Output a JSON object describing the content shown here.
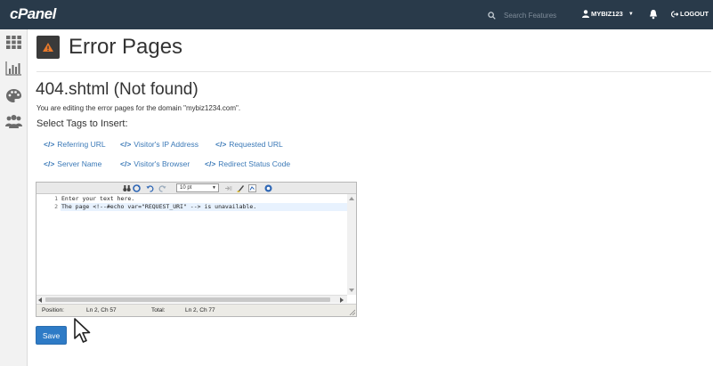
{
  "topbar": {
    "logo": "cPanel",
    "search_placeholder": "Search Features",
    "username": "MYBIZ123",
    "logout_label": "LOGOUT"
  },
  "sidebar": {
    "items": [
      {
        "icon": "grid-icon"
      },
      {
        "icon": "bar-chart-icon"
      },
      {
        "icon": "palette-icon"
      },
      {
        "icon": "users-icon"
      }
    ]
  },
  "page": {
    "title": "Error Pages",
    "file_title": "404.shtml (Not found)",
    "description": "You are editing the error pages for the domain \"mybiz1234.com\".",
    "tags_heading": "Select Tags to Insert:"
  },
  "tags": {
    "code_glyph": "</>",
    "items": [
      {
        "label": "Referring URL"
      },
      {
        "label": "Visitor's IP Address"
      },
      {
        "label": "Requested URL"
      },
      {
        "label": "Server Name"
      },
      {
        "label": "Visitor's Browser"
      },
      {
        "label": "Redirect Status Code"
      }
    ]
  },
  "editor": {
    "font_size": "10 pt",
    "lines": [
      {
        "number": "1",
        "text": "Enter your text here."
      },
      {
        "number": "2",
        "text": "The page <!--#echo var=\"REQUEST_URI\" --> is unavailable."
      }
    ],
    "status": {
      "position_label": "Position:",
      "position_value": "Ln 2, Ch 57",
      "total_label": "Total:",
      "total_value": "Ln 2, Ch 77"
    }
  },
  "actions": {
    "save_label": "Save"
  }
}
